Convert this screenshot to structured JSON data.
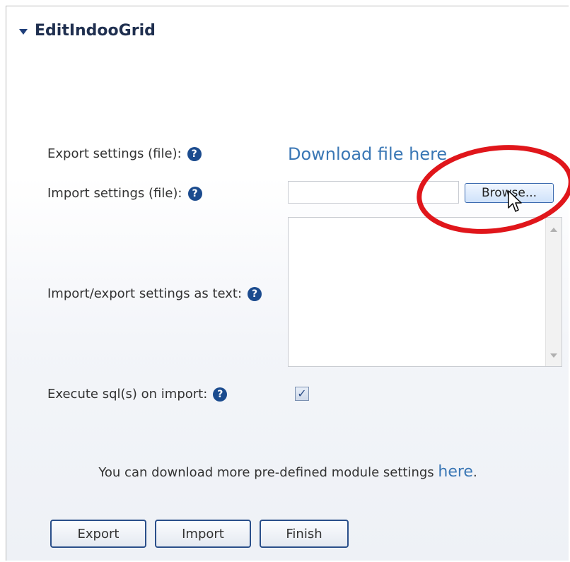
{
  "section": {
    "title": "EditIndooGrid",
    "toggle_icon": "triangle-down-icon"
  },
  "export_row": {
    "label": "Export settings (file):",
    "link_text": "Download file here"
  },
  "import_row": {
    "label": "Import settings (file):",
    "file_value": "",
    "browse_label": "Browse..."
  },
  "text_row": {
    "label": "Import/export settings as text:",
    "text_value": ""
  },
  "sql_row": {
    "label": "Execute sql(s) on import:",
    "checked": true
  },
  "more": {
    "text": "You can download more pre-defined module settings ",
    "link_text": "here",
    "suffix": "."
  },
  "buttons": {
    "export": "Export",
    "import": "Import",
    "finish": "Finish"
  },
  "icons": {
    "help": "question-circle-icon",
    "checkbox_mark": "✓"
  },
  "colors": {
    "accent": "#1b4b8e",
    "link": "#3a77b5",
    "annotation": "#e0161b"
  }
}
